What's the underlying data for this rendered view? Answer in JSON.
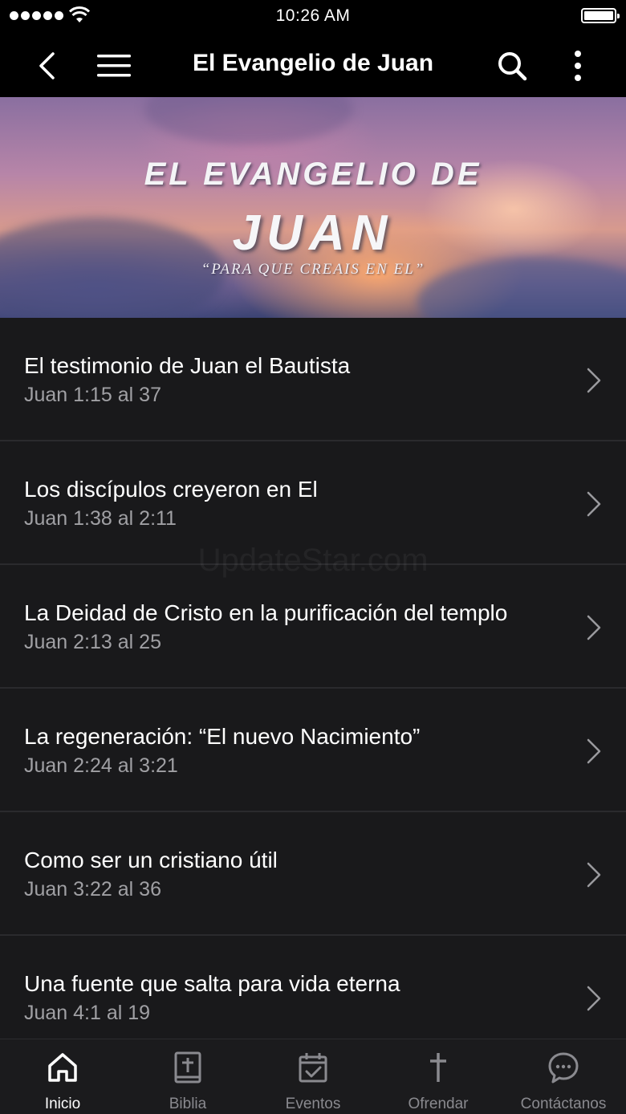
{
  "status_bar": {
    "time": "10:26 AM"
  },
  "nav": {
    "title": "El Evangelio de Juan"
  },
  "banner": {
    "line1": "EL EVANGELIO DE",
    "line2": "JUAN",
    "line3": "“PARA QUE CREAIS EN EL”"
  },
  "list": {
    "items": [
      {
        "title": "El testimonio de Juan el Bautista",
        "subtitle": "Juan 1:15 al 37"
      },
      {
        "title": "Los discípulos creyeron en El",
        "subtitle": "Juan 1:38 al 2:11"
      },
      {
        "title": "La Deidad de Cristo en la purificación del templo",
        "subtitle": "Juan 2:13 al 25"
      },
      {
        "title": "La regeneración: “El nuevo Nacimiento”",
        "subtitle": "Juan 2:24 al 3:21"
      },
      {
        "title": "Como ser un cristiano útil",
        "subtitle": "Juan 3:22 al 36"
      },
      {
        "title": "Una fuente que salta para vida eterna",
        "subtitle": "Juan 4:1 al 19"
      }
    ]
  },
  "watermark": "UpdateStar.com",
  "tabs": [
    {
      "label": "Inicio",
      "icon": "home-icon",
      "active": true
    },
    {
      "label": "Biblia",
      "icon": "bible-icon",
      "active": false
    },
    {
      "label": "Eventos",
      "icon": "calendar-check-icon",
      "active": false
    },
    {
      "label": "Ofrendar",
      "icon": "cross-icon",
      "active": false
    },
    {
      "label": "Contáctanos",
      "icon": "chat-bubble-icon",
      "active": false
    }
  ],
  "colors": {
    "background": "#19191b",
    "bar": "#000000",
    "tab_inactive": "#8a8a8f",
    "tab_active": "#ffffff"
  }
}
